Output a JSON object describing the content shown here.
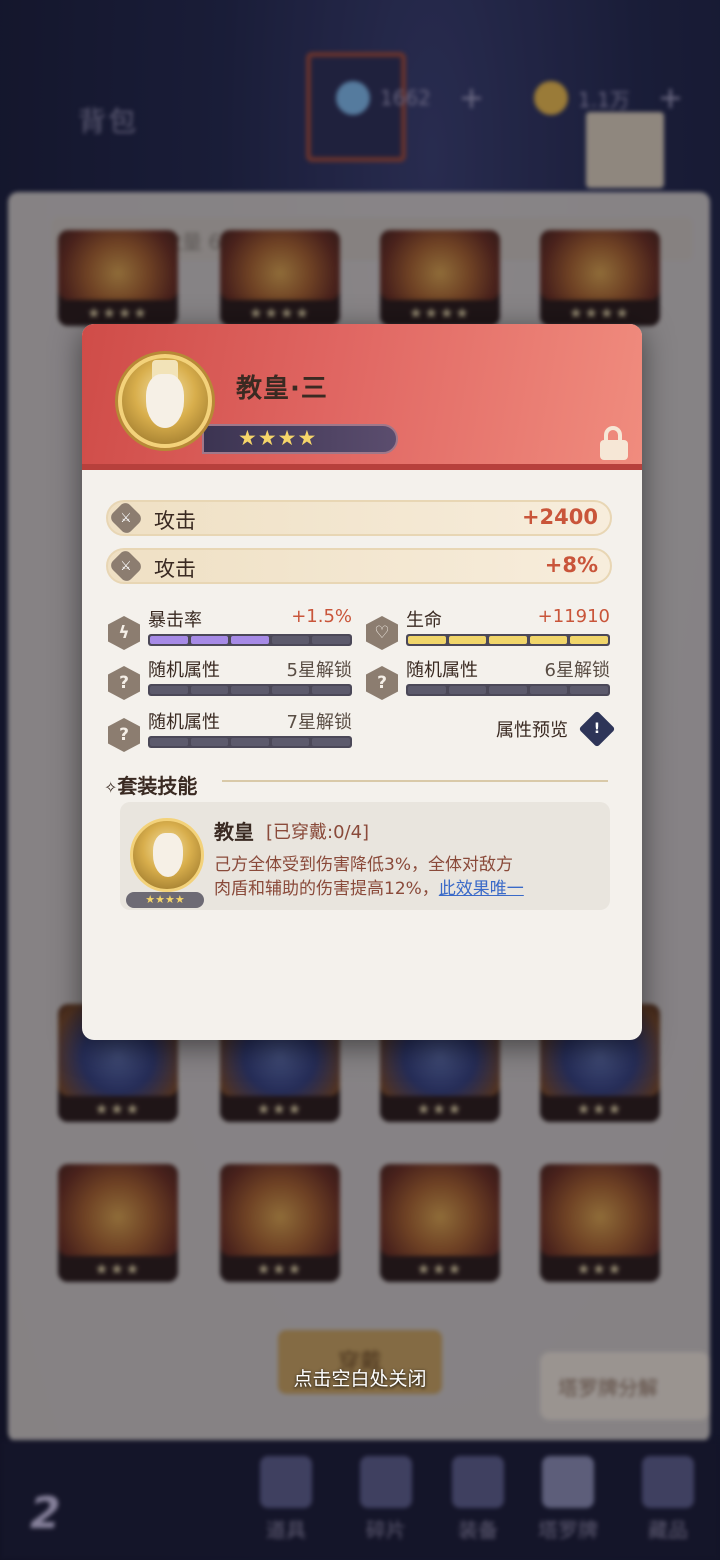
{
  "background": {
    "title": "背包",
    "currency_1": "1662",
    "currency_2": "1.1万",
    "inventory_count": "塔罗牌数量 63/300",
    "equip_button": "穿戴",
    "decompose_button": "塔罗牌分解",
    "nav": [
      "道具",
      "碎片",
      "装备",
      "塔罗牌",
      "藏品"
    ]
  },
  "card": {
    "name": "教皇·三",
    "stars": "★★★★",
    "main_stats": [
      {
        "label": "攻击",
        "value": "+2400",
        "icon": "sword-icon"
      },
      {
        "label": "攻击",
        "value": "+8%",
        "icon": "sword-icon"
      }
    ],
    "sub_stats": [
      {
        "label": "暴击率",
        "value": "+1.5%",
        "icon": "lightning-icon",
        "fill": 0.6
      },
      {
        "label": "生命",
        "value": "+11910",
        "icon": "heart-icon",
        "fill": 1.0
      },
      {
        "label": "随机属性",
        "value": "5星解锁",
        "icon": "question-icon"
      },
      {
        "label": "随机属性",
        "value": "6星解锁",
        "icon": "question-icon"
      },
      {
        "label": "随机属性",
        "value": "7星解锁",
        "icon": "question-icon"
      }
    ],
    "preview_label": "属性预览",
    "set_skill": {
      "title": "套装技能",
      "name": "教皇",
      "worn": "[已穿戴:0/4]",
      "stars": "★★★★",
      "desc_line1": "己方全体受到伤害降低3%，全体对敌方",
      "desc_line2": "肉盾和辅助的伤害提高12%，",
      "link": "此效果唯一"
    }
  },
  "close_hint": "点击空白处关闭",
  "colors": {
    "header_red": "#e06662",
    "value_red": "#c9553a",
    "link_blue": "#3a6ac8"
  }
}
